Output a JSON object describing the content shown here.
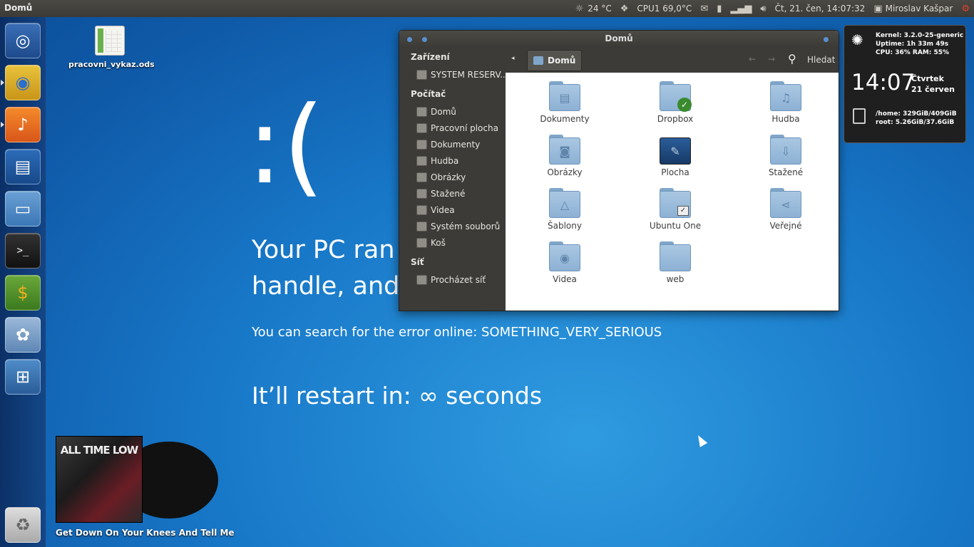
{
  "top_panel": {
    "app_title": "Domů",
    "weather": "24 °C",
    "cpu": "CPU1 69,0°C",
    "datetime": "Čt, 21. čen, 14:07:32",
    "user": "Miroslav Kašpar",
    "icons": [
      "weather-icon",
      "dropbox-icon",
      "mail-icon",
      "battery-icon",
      "network-icon",
      "volume-icon",
      "user-icon",
      "power-icon"
    ]
  },
  "launcher": {
    "items": [
      "ubuntu-dash",
      "chrome",
      "music-player",
      "writer",
      "files",
      "terminal",
      "finance-app",
      "paint-app",
      "workspace-switcher",
      "trash"
    ]
  },
  "desktop": {
    "file_label": "pracovni_vykaz.ods"
  },
  "bsod": {
    "sad_face": ":(",
    "line1": "Your PC ran i",
    "line2": "handle, and r",
    "search": "You can search for the error online: SOMETHING_VERY_SERIOUS",
    "restart": "It’ll restart in: ∞ seconds"
  },
  "file_manager": {
    "title": "Domů",
    "breadcrumb": "Domů",
    "search_label": "Hledat",
    "sidebar": {
      "devices_header": "Zařízení",
      "devices": [
        "SYSTEM RESERV..."
      ],
      "computer_header": "Počítač",
      "computer": [
        "Domů",
        "Pracovní plocha",
        "Dokumenty",
        "Hudba",
        "Obrázky",
        "Stažené",
        "Videa",
        "Systém souborů",
        "Koš"
      ],
      "network_header": "Síť",
      "network": [
        "Procházet síť"
      ]
    },
    "folders": [
      "Dokumenty",
      "Dropbox",
      "Hudba",
      "Obrázky",
      "Plocha",
      "Stažené",
      "Šablony",
      "Ubuntu One",
      "Veřejné",
      "Videa",
      "web"
    ]
  },
  "conky": {
    "kernel": "Kernel: 3.2.0-25-generic",
    "uptime": "Uptime: 1h 33m 49s",
    "cpu_ram": "CPU: 36%   RAM: 55%",
    "time": "14:07",
    "day": "Čtvrtek",
    "date": "21 červen",
    "home": "/home: 329GiB/409GiB",
    "root": "root: 5.26GiB/37.6GiB"
  },
  "album": {
    "cover_text": "ALL TIME LOW",
    "track": "Get Down On Your Knees And Tell Me"
  }
}
